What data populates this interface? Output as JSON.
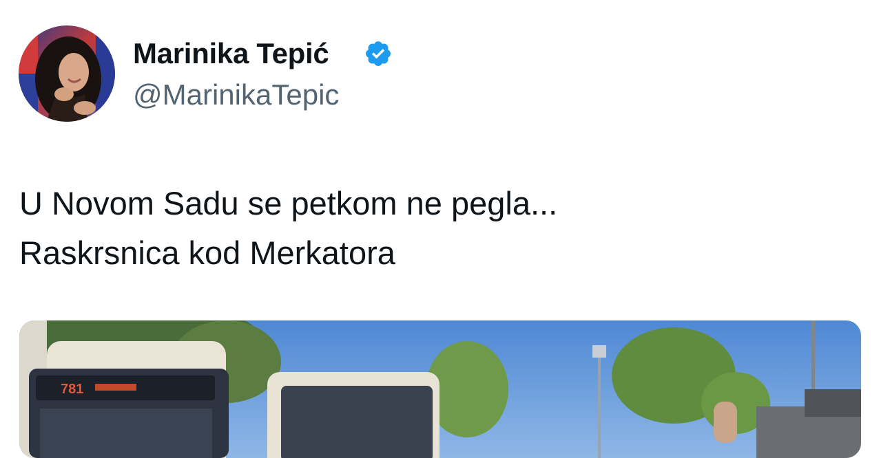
{
  "author": {
    "name": "Marinika Tepić",
    "handle": "@MarinikaTepic",
    "verified": true,
    "verified_color": "#1d9bf0",
    "avatar_icon": "profile-photo"
  },
  "tweet": {
    "lines": [
      "U Novom Sadu se petkom ne pegla...",
      "Raskrsnica kod Merkatora"
    ]
  },
  "media": {
    "type": "photo",
    "bus_route_label": "781"
  },
  "colors": {
    "text_primary": "#0f1419",
    "text_secondary": "#536471",
    "accent": "#1d9bf0"
  }
}
